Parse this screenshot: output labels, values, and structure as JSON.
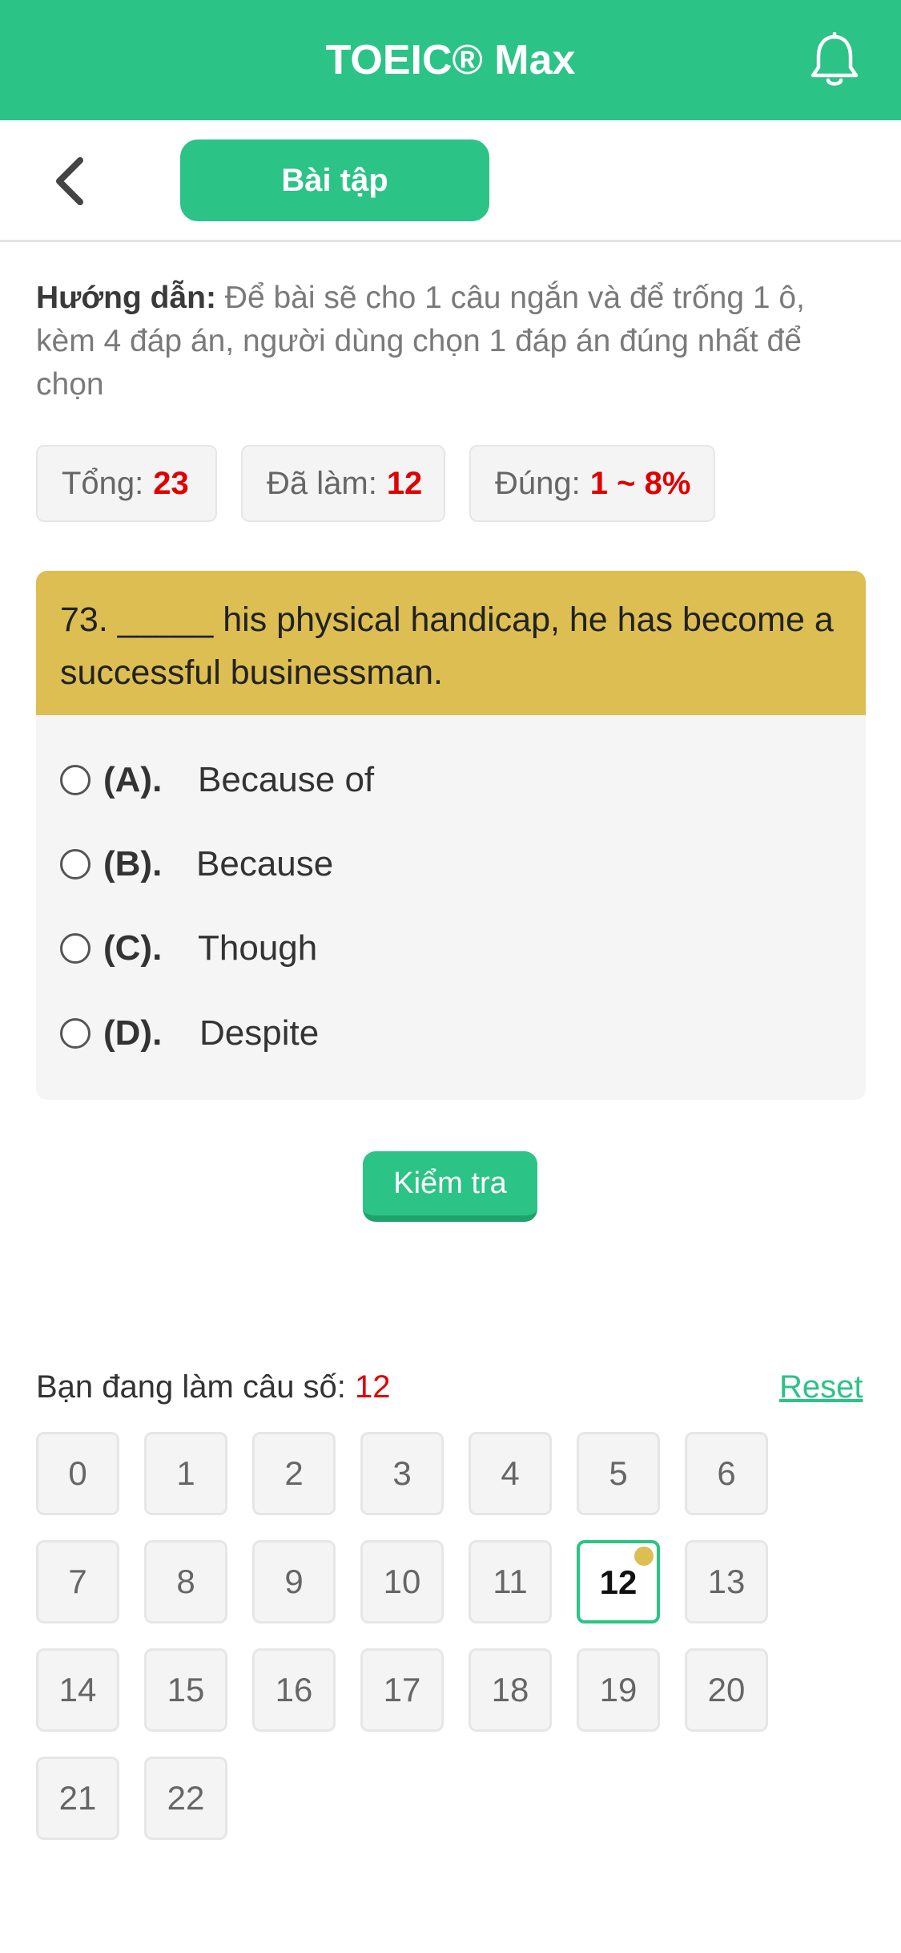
{
  "header": {
    "title": "TOEIC® Max",
    "bell_icon": "bell-icon"
  },
  "subheader": {
    "back_icon": "chevron-left-icon",
    "tab_label": "Bài tập"
  },
  "guide": {
    "label": "Hướng dẫn:",
    "text": "Để bài sẽ cho 1 câu ngắn và để trống 1 ô, kèm 4 đáp án, người dùng chọn 1 đáp án đúng nhất để chọn"
  },
  "stats": {
    "total_label": "Tổng:",
    "total_value": "23",
    "done_label": "Đã làm:",
    "done_value": "12",
    "correct_label": "Đúng:",
    "correct_value": "1 ~ 8%"
  },
  "question": {
    "text": "73. _____ his physical handicap, he has become a successful businessman.",
    "options": [
      {
        "letter": "(A).",
        "text": "Because of"
      },
      {
        "letter": "(B).",
        "text": "Because"
      },
      {
        "letter": "(C).",
        "text": "Though"
      },
      {
        "letter": "(D).",
        "text": "Despite"
      }
    ]
  },
  "check_button": "Kiểm tra",
  "navigator": {
    "current_label": "Bạn đang làm câu số:",
    "current_value": "12",
    "reset_label": "Reset",
    "numbers": [
      "0",
      "1",
      "2",
      "3",
      "4",
      "5",
      "6",
      "7",
      "8",
      "9",
      "10",
      "11",
      "12",
      "13",
      "14",
      "15",
      "16",
      "17",
      "18",
      "19",
      "20",
      "21",
      "22"
    ],
    "active": "12"
  },
  "colors": {
    "brand_green": "#2cc386",
    "question_header": "#dcbe52",
    "highlight_red": "#e00000"
  }
}
